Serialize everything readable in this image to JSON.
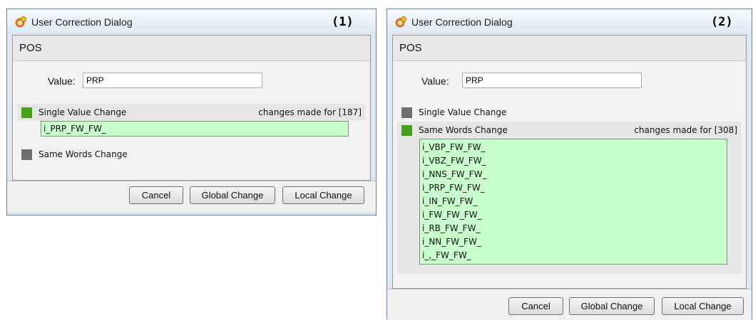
{
  "dialog1": {
    "title": "User Correction Dialog",
    "panel_number": "(1)",
    "section": "POS",
    "value_label": "Value:",
    "value": "PRP",
    "single_value_change": {
      "label": "Single Value Change",
      "changes": "changes made for [187]",
      "selected": true
    },
    "same_words_change": {
      "label": "Same Words Change",
      "selected": false
    },
    "list_items": [
      "i_PRP_FW_FW_"
    ],
    "buttons": {
      "cancel": "Cancel",
      "global": "Global Change",
      "local": "Local Change"
    }
  },
  "dialog2": {
    "title": "User Correction Dialog",
    "panel_number": "(2)",
    "section": "POS",
    "value_label": "Value:",
    "value": "PRP",
    "single_value_change": {
      "label": "Single Value Change",
      "selected": false
    },
    "same_words_change": {
      "label": "Same Words Change",
      "changes": "changes made for [308]",
      "selected": true
    },
    "list_items": [
      "i_VBP_FW_FW_",
      "i_VBZ_FW_FW_",
      "i_NNS_FW_FW_",
      "i_PRP_FW_FW_",
      "i_IN_FW_FW_",
      "i_FW_FW_FW_",
      "i_RB_FW_FW_",
      "i_NN_FW_FW_",
      "i_,_FW_FW_"
    ],
    "buttons": {
      "cancel": "Cancel",
      "global": "Global Change",
      "local": "Local Change"
    }
  },
  "colors": {
    "selected": "#44a017",
    "unselected": "#6f6f6f",
    "list_background": "#c9ffcc"
  },
  "icons": {
    "app": "user-correction-app-icon"
  }
}
